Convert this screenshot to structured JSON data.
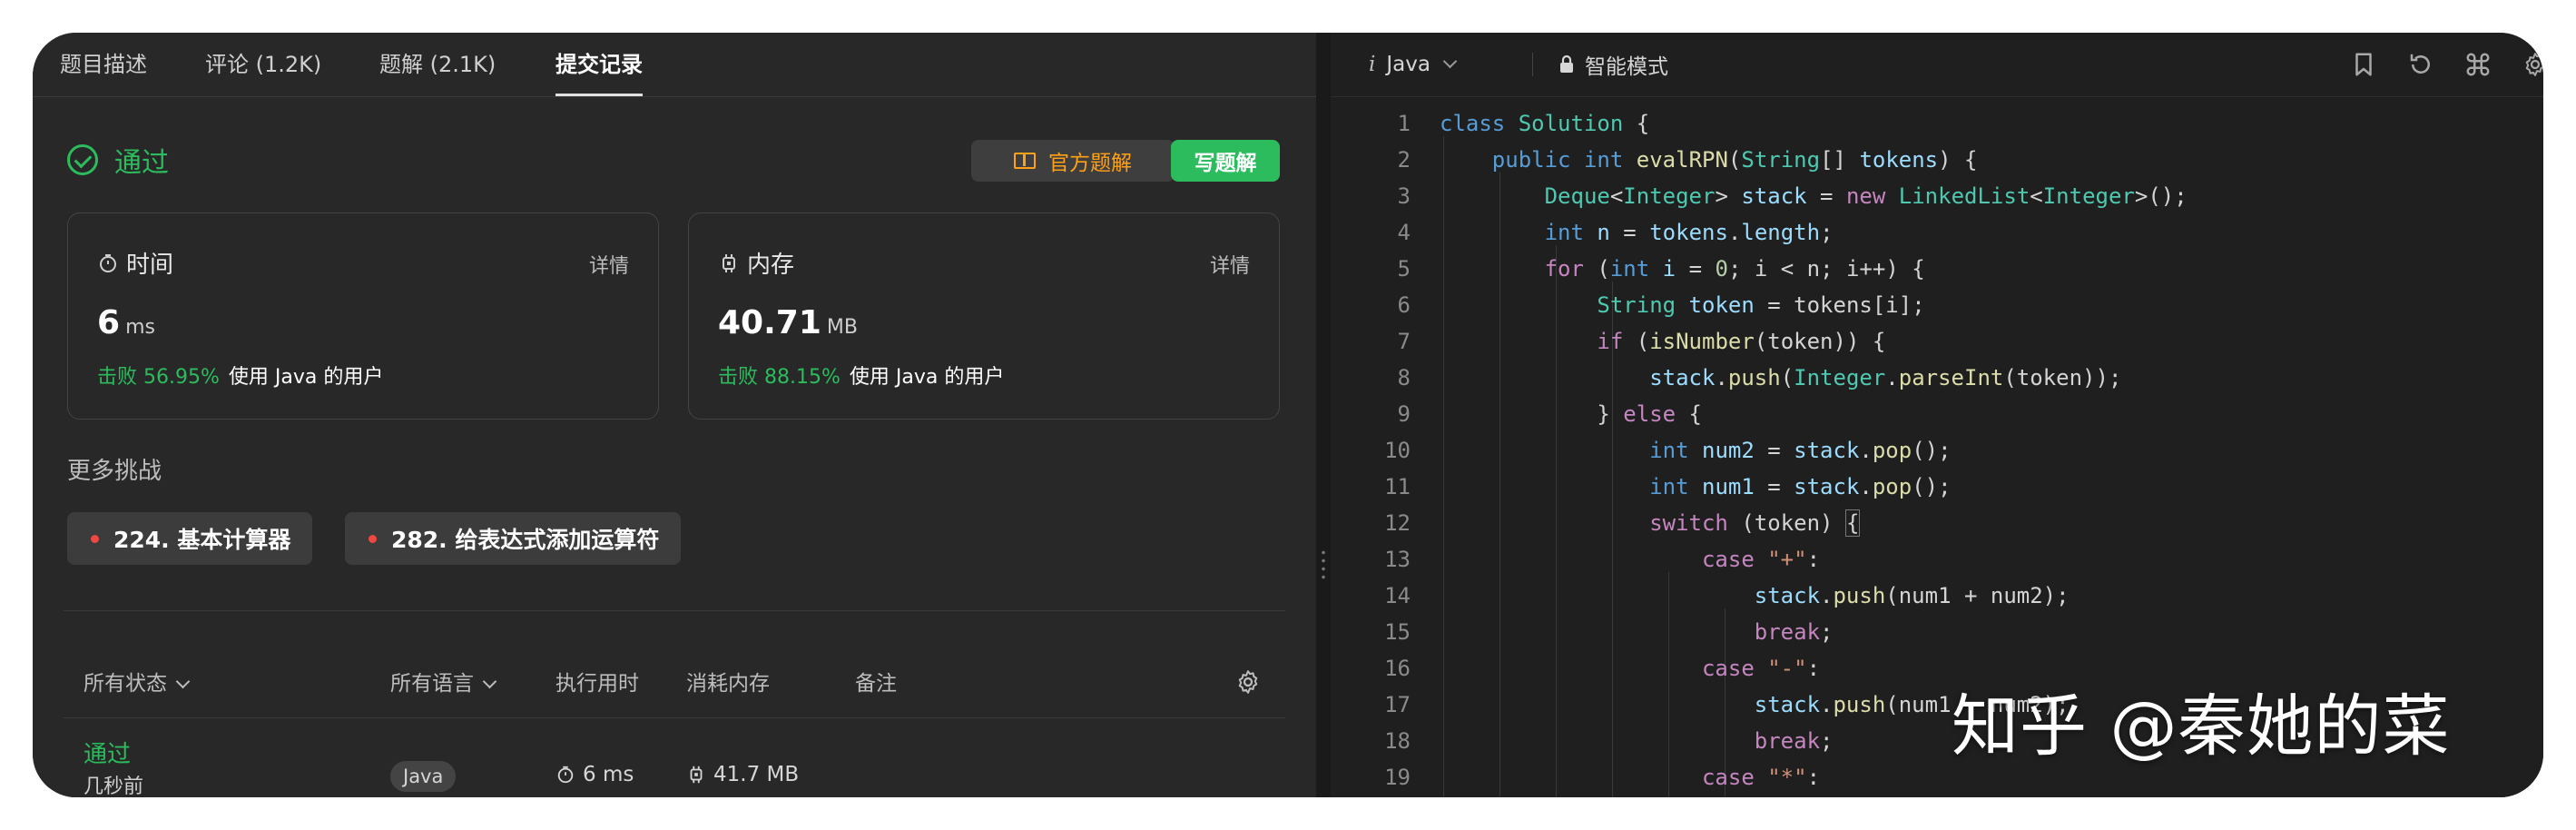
{
  "tabs": [
    {
      "label": "题目描述"
    },
    {
      "label": "评论 (1.2K)"
    },
    {
      "label": "题解 (2.1K)"
    },
    {
      "label": "提交记录"
    }
  ],
  "result": {
    "status": "通过",
    "official_solution": "官方题解",
    "write_solution": "写题解"
  },
  "runtime_card": {
    "title": "时间",
    "detail": "详情",
    "value": "6",
    "unit": "ms",
    "beat_pct": "击败 56.95%",
    "beat_text": "使用 Java 的用户"
  },
  "memory_card": {
    "title": "内存",
    "detail": "详情",
    "value": "40.71",
    "unit": "MB",
    "beat_pct": "击败 88.15%",
    "beat_text": "使用 Java 的用户"
  },
  "more_challenges": {
    "title": "更多挑战",
    "items": [
      "224. 基本计算器",
      "282. 给表达式添加运算符"
    ]
  },
  "table": {
    "headers": [
      "所有状态",
      "所有语言",
      "执行用时",
      "消耗内存",
      "备注"
    ],
    "rows": [
      {
        "status": "通过",
        "time": "几秒前",
        "language": "Java",
        "runtime": "6 ms",
        "memory": "41.7 MB"
      }
    ]
  },
  "editor": {
    "language": "Java",
    "mode": "智能模式",
    "line_numbers": [
      "1",
      "2",
      "3",
      "4",
      "5",
      "6",
      "7",
      "8",
      "9",
      "10",
      "11",
      "12",
      "13",
      "14",
      "15",
      "16",
      "17",
      "18",
      "19"
    ]
  },
  "watermark": "知乎 @秦她的菜",
  "colors": {
    "accent_green": "#2cbb5d",
    "accent_orange": "#ffa116",
    "dot_red": "#ef4743"
  }
}
